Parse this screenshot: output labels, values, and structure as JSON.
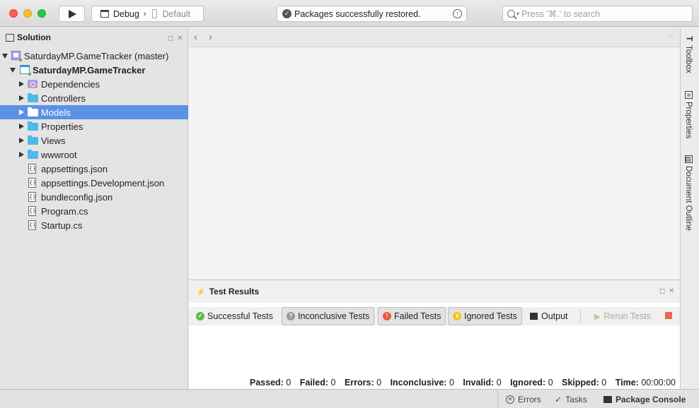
{
  "toolbar": {
    "config": "Debug",
    "separator": "›",
    "device": "Default",
    "status": "Packages successfully restored.",
    "search_placeholder": "Press '⌘.' to search"
  },
  "solution_pad": {
    "title": "Solution",
    "items": [
      {
        "label": "SaturdayMP.GameTracker (master)",
        "type": "solution",
        "expanded": true
      },
      {
        "label": "SaturdayMP.GameTracker",
        "type": "project",
        "expanded": true
      },
      {
        "label": "Dependencies",
        "type": "dependencies"
      },
      {
        "label": "Controllers",
        "type": "folder"
      },
      {
        "label": "Models",
        "type": "folder",
        "selected": true
      },
      {
        "label": "Properties",
        "type": "folder"
      },
      {
        "label": "Views",
        "type": "folder"
      },
      {
        "label": "wwwroot",
        "type": "folder"
      },
      {
        "label": "appsettings.json",
        "type": "file"
      },
      {
        "label": "appsettings.Development.json",
        "type": "file"
      },
      {
        "label": "bundleconfig.json",
        "type": "file"
      },
      {
        "label": "Program.cs",
        "type": "file"
      },
      {
        "label": "Startup.cs",
        "type": "file"
      }
    ]
  },
  "right_tabs": [
    "Toolbox",
    "Properties",
    "Document Outline"
  ],
  "test_results": {
    "title": "Test Results",
    "filters": {
      "successful": "Successful Tests",
      "inconclusive": "Inconclusive Tests",
      "failed": "Failed Tests",
      "ignored": "Ignored Tests",
      "output": "Output",
      "rerun": "Rerun Tests"
    },
    "summary": {
      "passed_label": "Passed:",
      "passed": "0",
      "failed_label": "Failed:",
      "failed": "0",
      "errors_label": "Errors:",
      "errors": "0",
      "inconclusive_label": "Inconclusive:",
      "inconclusive": "0",
      "invalid_label": "Invalid:",
      "invalid": "0",
      "ignored_label": "Ignored:",
      "ignored": "0",
      "skipped_label": "Skipped:",
      "skipped": "0",
      "time_label": "Time:",
      "time": "00:00:00"
    }
  },
  "statusbar": {
    "errors": "Errors",
    "tasks": "Tasks",
    "package_console": "Package Console"
  },
  "colors": {
    "selection": "#5b92e5",
    "folder": "#4fb8e8",
    "success": "#5fba4c",
    "failed": "#e85a3a",
    "ignored": "#f0c419"
  }
}
